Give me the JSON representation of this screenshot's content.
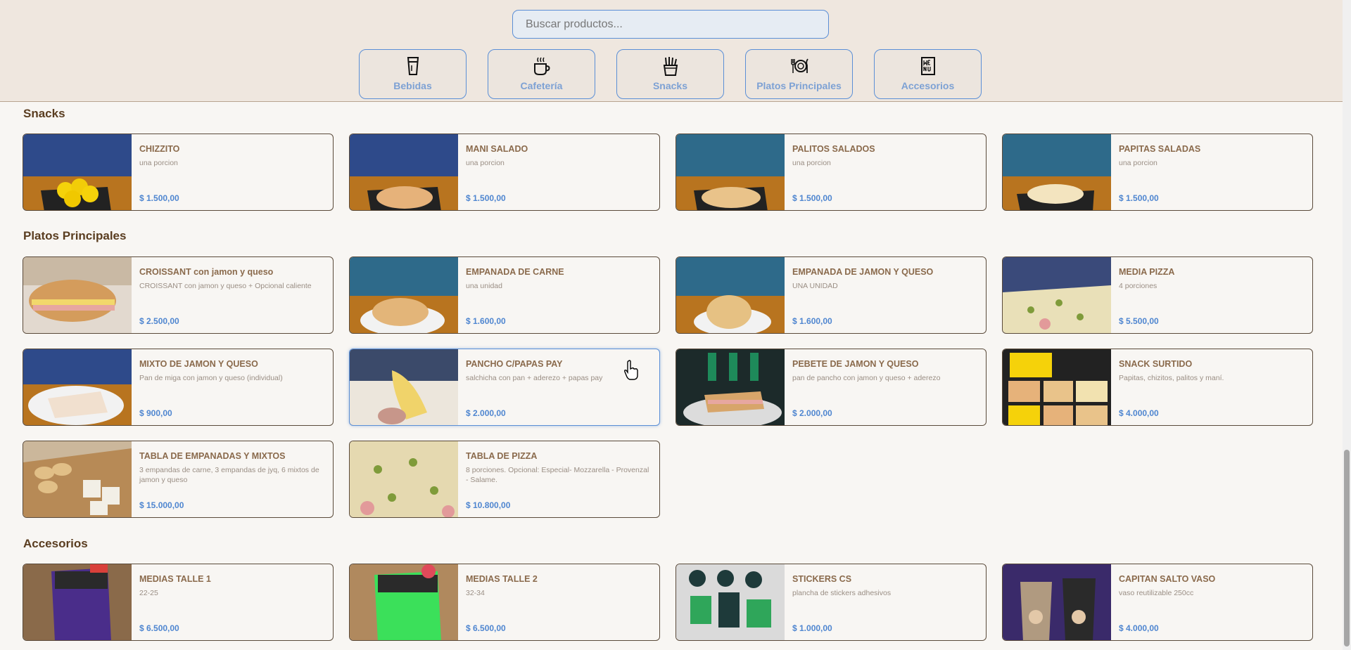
{
  "search": {
    "placeholder": "Buscar productos..."
  },
  "categories": [
    {
      "label": "Bebidas",
      "icon": "glass-icon"
    },
    {
      "label": "Cafetería",
      "icon": "coffee-cup-icon"
    },
    {
      "label": "Snacks",
      "icon": "fries-icon"
    },
    {
      "label": "Platos Principales",
      "icon": "plate-cutlery-icon"
    },
    {
      "label": "Accesorios",
      "icon": "menu-icon"
    }
  ],
  "sections": [
    {
      "title": "Snacks",
      "items": [
        {
          "name": "CHIZZITO",
          "desc": "una porcion",
          "price": "$ 1.500,00"
        },
        {
          "name": "MANI SALADO",
          "desc": "una porcion",
          "price": "$ 1.500,00"
        },
        {
          "name": "PALITOS SALADOS",
          "desc": "una porcion",
          "price": "$ 1.500,00"
        },
        {
          "name": "PAPITAS SALADAS",
          "desc": "una porcion",
          "price": "$ 1.500,00"
        }
      ]
    },
    {
      "title": "Platos Principales",
      "items": [
        {
          "name": "CROISSANT con jamon y queso",
          "desc": "CROISSANT con jamon y queso + Opcional caliente",
          "price": "$ 2.500,00"
        },
        {
          "name": "EMPANADA DE CARNE",
          "desc": "una unidad",
          "price": "$ 1.600,00"
        },
        {
          "name": "EMPANADA DE JAMON Y QUESO",
          "desc": "UNA UNIDAD",
          "price": "$ 1.600,00"
        },
        {
          "name": "MEDIA PIZZA",
          "desc": "4 porciones",
          "price": "$ 5.500,00"
        },
        {
          "name": "MIXTO DE JAMON Y QUESO",
          "desc": "Pan de miga con jamon y queso (individual)",
          "price": "$ 900,00"
        },
        {
          "name": "PANCHO C/PAPAS PAY",
          "desc": "salchicha con pan + aderezo + papas pay",
          "price": "$ 2.000,00"
        },
        {
          "name": "PEBETE DE JAMON Y QUESO",
          "desc": "pan de pancho con jamon y queso + aderezo",
          "price": "$ 2.000,00"
        },
        {
          "name": "SNACK SURTIDO",
          "desc": "Papitas, chizitos, palitos y maní.",
          "price": "$ 4.000,00"
        },
        {
          "name": "TABLA DE EMPANADAS Y MIXTOS",
          "desc": "3 empandas de carne, 3 empandas de jyq, 6 mixtos de jamon y queso",
          "price": "$ 15.000,00"
        },
        {
          "name": "TABLA DE PIZZA",
          "desc": "8 porciones. Opcional: Especial- Mozzarella - Provenzal - Salame.",
          "price": "$ 10.800,00"
        }
      ]
    },
    {
      "title": "Accesorios",
      "items": [
        {
          "name": "MEDIAS TALLE 1",
          "desc": "22-25",
          "price": "$ 6.500,00"
        },
        {
          "name": "MEDIAS TALLE 2",
          "desc": "32-34",
          "price": "$ 6.500,00"
        },
        {
          "name": "STICKERS CS",
          "desc": "plancha de stickers adhesivos",
          "price": "$ 1.000,00"
        },
        {
          "name": "CAPITAN SALTO VASO",
          "desc": "vaso reutilizable 250cc",
          "price": "$ 4.000,00"
        }
      ]
    }
  ],
  "colors": {
    "accent": "#5b8fd6",
    "price": "#4f86d0",
    "heading": "#5a3d20",
    "header_bg": "#efe7df"
  }
}
